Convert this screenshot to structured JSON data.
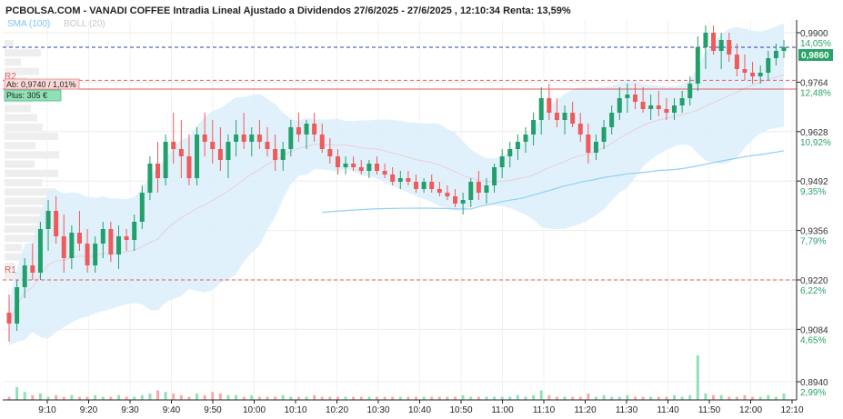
{
  "header": {
    "title": "PCBOLSA.COM - VANADI COFFEE Intradia Lineal Ajustado a Dividendos 27/6/2025 - 27/6/2025 , 12:10:34 Renta: 13,59%",
    "legend_sma": "SMA (100)",
    "legend_boll": "BOLL (20)"
  },
  "boxes": {
    "ab_label": "Ab: 0,9740 / 1,01%",
    "plus_label": "Plus: 305 €"
  },
  "levels": {
    "r2_label": "R2",
    "r1_label": "R1",
    "r2_value": 0.9745,
    "r1_value": 0.922,
    "last_value": 0.986
  },
  "colors": {
    "up": "#22a06b",
    "down": "#ef5a5a",
    "band": "#dceffc",
    "sma": "#8fd0f5",
    "last_line": "#2b3fb3",
    "level": "#e35b5b"
  },
  "chart_data": {
    "type": "candlestick",
    "title": "PCBOLSA.COM - VANADI COFFEE Intradia Lineal Ajustado a Dividendos 27/6/2025 - 27/6/2025 , 12:10:34 Renta: 13,59%",
    "x_ticks": [
      "9:10",
      "9:20",
      "9:30",
      "9:40",
      "9:50",
      "10:00",
      "10:10",
      "10:20",
      "10:30",
      "10:40",
      "10:50",
      "11:00",
      "11:10",
      "11:20",
      "11:30",
      "11:40",
      "11:50",
      "12:00",
      "12:10"
    ],
    "y_ticks": [
      {
        "price": "0,9900",
        "pct": "14,05%"
      },
      {
        "price": "0,9764",
        "pct": "12,48%"
      },
      {
        "price": "0,9628",
        "pct": "10,92%"
      },
      {
        "price": "0,9492",
        "pct": "9,35%"
      },
      {
        "price": "0,9356",
        "pct": "7,79%"
      },
      {
        "price": "0,9220",
        "pct": "6,22%"
      },
      {
        "price": "0,9084",
        "pct": "4,65%"
      },
      {
        "price": "0,8940",
        "pct": "2,99%"
      }
    ],
    "last_price_label": "0,9860",
    "ylim": [
      0.889,
      0.9935
    ],
    "grid": true,
    "candles": [
      [
        0.913,
        0.918,
        0.905,
        0.91
      ],
      [
        0.91,
        0.922,
        0.908,
        0.92
      ],
      [
        0.92,
        0.928,
        0.917,
        0.926
      ],
      [
        0.926,
        0.932,
        0.922,
        0.924
      ],
      [
        0.924,
        0.938,
        0.922,
        0.936
      ],
      [
        0.936,
        0.944,
        0.93,
        0.941
      ],
      [
        0.941,
        0.945,
        0.932,
        0.934
      ],
      [
        0.934,
        0.94,
        0.924,
        0.928
      ],
      [
        0.928,
        0.937,
        0.925,
        0.935
      ],
      [
        0.935,
        0.941,
        0.93,
        0.932
      ],
      [
        0.932,
        0.936,
        0.924,
        0.926
      ],
      [
        0.926,
        0.934,
        0.924,
        0.932
      ],
      [
        0.932,
        0.938,
        0.928,
        0.936
      ],
      [
        0.936,
        0.938,
        0.927,
        0.929
      ],
      [
        0.929,
        0.937,
        0.925,
        0.934
      ],
      [
        0.934,
        0.936,
        0.93,
        0.933
      ],
      [
        0.933,
        0.94,
        0.93,
        0.938
      ],
      [
        0.938,
        0.948,
        0.936,
        0.946
      ],
      [
        0.946,
        0.956,
        0.944,
        0.954
      ],
      [
        0.954,
        0.96,
        0.946,
        0.95
      ],
      [
        0.95,
        0.962,
        0.948,
        0.96
      ],
      [
        0.96,
        0.968,
        0.954,
        0.958
      ],
      [
        0.958,
        0.966,
        0.95,
        0.956
      ],
      [
        0.956,
        0.962,
        0.948,
        0.95
      ],
      [
        0.95,
        0.964,
        0.948,
        0.962
      ],
      [
        0.962,
        0.968,
        0.956,
        0.96
      ],
      [
        0.96,
        0.966,
        0.954,
        0.958
      ],
      [
        0.958,
        0.964,
        0.952,
        0.955
      ],
      [
        0.955,
        0.962,
        0.95,
        0.96
      ],
      [
        0.96,
        0.966,
        0.956,
        0.962
      ],
      [
        0.962,
        0.968,
        0.958,
        0.96
      ],
      [
        0.96,
        0.964,
        0.956,
        0.962
      ],
      [
        0.962,
        0.966,
        0.958,
        0.96
      ],
      [
        0.96,
        0.964,
        0.956,
        0.958
      ],
      [
        0.958,
        0.962,
        0.952,
        0.955
      ],
      [
        0.955,
        0.96,
        0.952,
        0.958
      ],
      [
        0.958,
        0.966,
        0.956,
        0.964
      ],
      [
        0.964,
        0.968,
        0.96,
        0.962
      ],
      [
        0.962,
        0.966,
        0.958,
        0.965
      ],
      [
        0.965,
        0.968,
        0.96,
        0.962
      ],
      [
        0.962,
        0.965,
        0.957,
        0.958
      ],
      [
        0.958,
        0.961,
        0.954,
        0.956
      ],
      [
        0.956,
        0.958,
        0.951,
        0.953
      ],
      [
        0.953,
        0.956,
        0.951,
        0.954
      ],
      [
        0.954,
        0.956,
        0.952,
        0.953
      ],
      [
        0.953,
        0.955,
        0.951,
        0.952
      ],
      [
        0.952,
        0.955,
        0.95,
        0.954
      ],
      [
        0.954,
        0.956,
        0.951,
        0.952
      ],
      [
        0.952,
        0.954,
        0.95,
        0.951
      ],
      [
        0.951,
        0.953,
        0.948,
        0.949
      ],
      [
        0.949,
        0.952,
        0.947,
        0.95
      ],
      [
        0.95,
        0.952,
        0.948,
        0.949
      ],
      [
        0.949,
        0.951,
        0.946,
        0.947
      ],
      [
        0.947,
        0.95,
        0.946,
        0.949
      ],
      [
        0.949,
        0.951,
        0.946,
        0.947
      ],
      [
        0.947,
        0.949,
        0.945,
        0.946
      ],
      [
        0.946,
        0.948,
        0.944,
        0.945
      ],
      [
        0.945,
        0.947,
        0.942,
        0.943
      ],
      [
        0.943,
        0.946,
        0.94,
        0.944
      ],
      [
        0.944,
        0.95,
        0.942,
        0.949
      ],
      [
        0.949,
        0.952,
        0.944,
        0.946
      ],
      [
        0.946,
        0.95,
        0.943,
        0.948
      ],
      [
        0.948,
        0.954,
        0.946,
        0.953
      ],
      [
        0.953,
        0.958,
        0.95,
        0.956
      ],
      [
        0.956,
        0.96,
        0.953,
        0.958
      ],
      [
        0.958,
        0.962,
        0.955,
        0.96
      ],
      [
        0.96,
        0.964,
        0.957,
        0.962
      ],
      [
        0.962,
        0.968,
        0.959,
        0.966
      ],
      [
        0.966,
        0.975,
        0.962,
        0.972
      ],
      [
        0.972,
        0.976,
        0.966,
        0.968
      ],
      [
        0.968,
        0.972,
        0.964,
        0.966
      ],
      [
        0.966,
        0.97,
        0.962,
        0.968
      ],
      [
        0.968,
        0.971,
        0.964,
        0.965
      ],
      [
        0.965,
        0.968,
        0.96,
        0.962
      ],
      [
        0.962,
        0.965,
        0.954,
        0.957
      ],
      [
        0.957,
        0.962,
        0.955,
        0.96
      ],
      [
        0.96,
        0.966,
        0.958,
        0.964
      ],
      [
        0.964,
        0.97,
        0.962,
        0.968
      ],
      [
        0.968,
        0.975,
        0.966,
        0.972
      ],
      [
        0.972,
        0.976,
        0.968,
        0.973
      ],
      [
        0.973,
        0.976,
        0.969,
        0.971
      ],
      [
        0.971,
        0.975,
        0.968,
        0.969
      ],
      [
        0.969,
        0.973,
        0.966,
        0.97
      ],
      [
        0.97,
        0.974,
        0.967,
        0.969
      ],
      [
        0.969,
        0.972,
        0.966,
        0.968
      ],
      [
        0.968,
        0.972,
        0.966,
        0.97
      ],
      [
        0.97,
        0.974,
        0.968,
        0.972
      ],
      [
        0.972,
        0.978,
        0.97,
        0.976
      ],
      [
        0.976,
        0.989,
        0.974,
        0.986
      ],
      [
        0.986,
        0.992,
        0.98,
        0.99
      ],
      [
        0.99,
        0.992,
        0.984,
        0.985
      ],
      [
        0.985,
        0.99,
        0.98,
        0.988
      ],
      [
        0.988,
        0.99,
        0.982,
        0.984
      ],
      [
        0.984,
        0.987,
        0.978,
        0.98
      ],
      [
        0.98,
        0.984,
        0.977,
        0.979
      ],
      [
        0.979,
        0.982,
        0.976,
        0.978
      ],
      [
        0.978,
        0.981,
        0.976,
        0.979
      ],
      [
        0.979,
        0.985,
        0.977,
        0.983
      ],
      [
        0.983,
        0.987,
        0.981,
        0.985
      ],
      [
        0.985,
        0.988,
        0.983,
        0.986
      ]
    ],
    "volume": [
      2,
      8,
      5,
      3,
      4,
      2,
      3,
      2,
      3,
      2,
      2,
      3,
      2,
      2,
      3,
      2,
      2,
      3,
      4,
      6,
      5,
      4,
      3,
      2,
      4,
      3,
      5,
      4,
      3,
      3,
      2,
      3,
      2,
      2,
      2,
      3,
      2,
      2,
      2,
      3,
      2,
      2,
      2,
      2,
      2,
      2,
      2,
      2,
      2,
      2,
      2,
      2,
      2,
      2,
      2,
      2,
      2,
      2,
      3,
      2,
      2,
      2,
      2,
      2,
      2,
      3,
      2,
      3,
      6,
      3,
      2,
      2,
      2,
      2,
      4,
      2,
      3,
      2,
      2,
      3,
      2,
      2,
      2,
      2,
      2,
      3,
      2,
      3,
      28,
      4,
      3,
      3,
      2,
      2,
      3,
      2,
      2,
      3,
      2,
      4
    ],
    "volume_max": 40
  }
}
